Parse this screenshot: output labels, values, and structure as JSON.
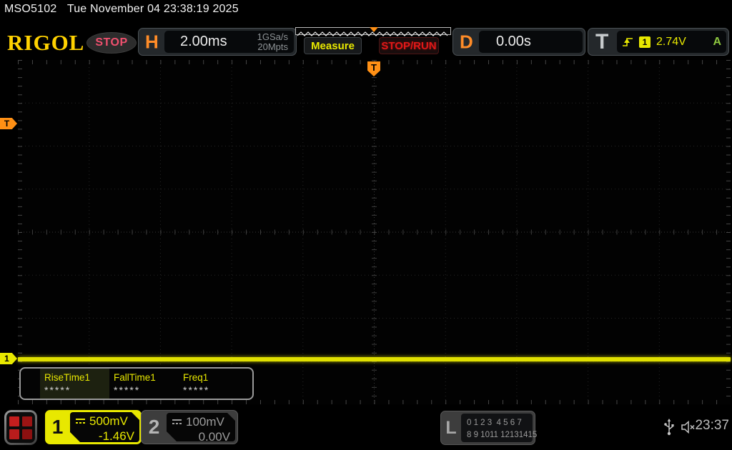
{
  "statusbar": {
    "model": "MSO5102",
    "datetime": "Tue November 04 23:38:19 2025"
  },
  "header": {
    "brand": "RIGOL",
    "acq_status": "STOP",
    "horizontal": {
      "label": "H",
      "scale": "2.00ms",
      "sample_rate": "1GSa/s",
      "memory_depth": "20Mpts"
    },
    "measure_button": "Measure",
    "run_button": "STOP/RUN",
    "delay": {
      "label": "D",
      "value": "0.00s"
    },
    "trigger": {
      "label": "T",
      "source_badge": "1",
      "level": "2.74V",
      "mode": "A"
    }
  },
  "grid": {
    "trigger_position_marker": "T",
    "trigger_level_marker": "T",
    "ch1_marker": "1"
  },
  "measurements": {
    "items": [
      {
        "label": "RiseTime1",
        "value": "*****"
      },
      {
        "label": "FallTime1",
        "value": "*****"
      },
      {
        "label": "Freq1",
        "value": "*****"
      }
    ]
  },
  "footer": {
    "ch1": {
      "number": "1",
      "scale": "500mV",
      "offset": "-1.46V"
    },
    "ch2": {
      "number": "2",
      "scale": "100mV",
      "offset": "0.00V"
    },
    "logic": {
      "label": "L",
      "row1": "0 1 2 3  4 5 6 7",
      "row2": "8 9 1011 12131415"
    },
    "clock": "23:37"
  },
  "colors": {
    "ch1_yellow": "#e8e800",
    "trigger_orange": "#ff9015",
    "run_red": "#e01818",
    "auto_green": "#8cc63f",
    "stop_pink": "#f0506e",
    "brand_gold": "#ffd200"
  }
}
